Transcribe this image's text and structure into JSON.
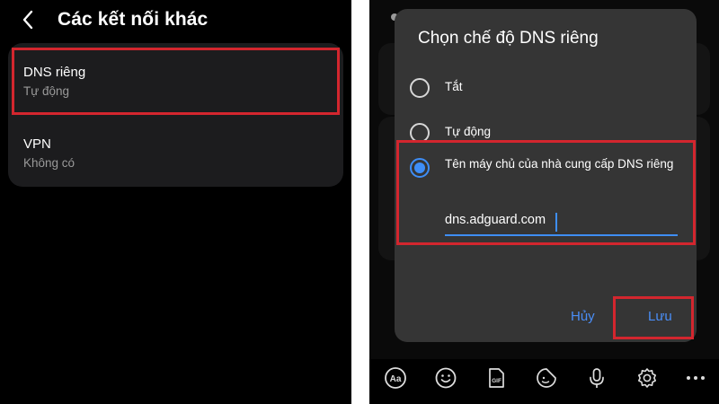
{
  "left": {
    "title": "Các kết nối khác",
    "items": [
      {
        "title": "DNS riêng",
        "subtitle": "Tự động"
      },
      {
        "title": "VPN",
        "subtitle": "Không có"
      }
    ]
  },
  "dialog": {
    "title": "Chọn chế độ DNS riêng",
    "options": [
      {
        "label": "Tắt",
        "selected": false
      },
      {
        "label": "Tự động",
        "selected": false
      },
      {
        "label": "Tên máy chủ của nhà cung cấp DNS riêng",
        "selected": true
      }
    ],
    "hostname_value": "dns.adguard.com",
    "cancel_label": "Hủy",
    "save_label": "Lưu"
  },
  "keyboard_toolbar": {
    "icons": [
      "text-style-icon",
      "emoji-icon",
      "gif-icon",
      "sticker-icon",
      "microphone-icon",
      "settings-icon",
      "more-icon"
    ]
  },
  "colors": {
    "accent": "#3e8ef7",
    "highlight": "#d3262e",
    "dialog_bg": "#353535",
    "card_bg": "#1c1c1e"
  }
}
